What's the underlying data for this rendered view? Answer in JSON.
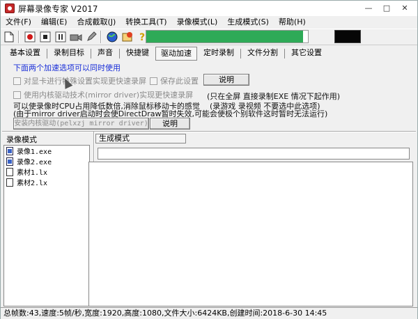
{
  "window": {
    "title": "屏幕录像专家 V2017",
    "controls": [
      "—",
      "□",
      "✕"
    ]
  },
  "menu": [
    "文件(F)",
    "编辑(E)",
    "合成截取(J)",
    "转换工具(T)",
    "录像模式(L)",
    "生成模式(S)",
    "帮助(H)"
  ],
  "toolbar": {
    "icons": [
      "document-icon",
      "record-icon",
      "stop-icon",
      "pause-icon",
      "camera-icon",
      "pencil-icon",
      "globe-icon",
      "settings-icon",
      "help-icon"
    ],
    "progress_fraction": 0.97,
    "progress_color": "#2eaa57"
  },
  "tabs": [
    "基本设置",
    "录制目标",
    "声音",
    "快捷键",
    "驱动加速",
    "定时录制",
    "文件分割",
    "其它设置"
  ],
  "active_tab": "驱动加速",
  "panel": {
    "blue_note": "下面两个加速选项可以同时使用",
    "option1": "对显卡进行特殊设置实现更快速录屏",
    "option2": "保存此设置",
    "explain1": "说明",
    "option3": "使用内核驱动技术(mirror driver)实现更快速录屏",
    "note_fullscreen": "(只在全屏 直接录制EXE 情况下起作用)",
    "note_game": "(录游戏 录视频 不要选中此选项)",
    "note_cpu": "可以使录像时CPU占用降低数倍,消除鼠标移动卡的感觉",
    "note_mirror": "(由于mirror driver启动时会使DirectDraw暂时失效,可能会使极个别软件这时暂时无法运行)",
    "install_btn": "安装内核驱动(pelxzj mirror driver)",
    "explain2": "说明"
  },
  "left_section": {
    "label": "录像模式",
    "files": [
      {
        "name": "录像1.exe",
        "icon": "film-file-icon"
      },
      {
        "name": "录像2.exe",
        "icon": "film-file-icon"
      },
      {
        "name": "素材1.lx",
        "icon": "file-icon"
      },
      {
        "name": "素材2.lx",
        "icon": "file-icon"
      }
    ]
  },
  "right_section": {
    "label": "生成模式"
  },
  "status": "总帧数:43,速度:5帧/秒,宽度:1920,高度:1080,文件大小:6424KB,创建时间:2018-6-30 14:45"
}
